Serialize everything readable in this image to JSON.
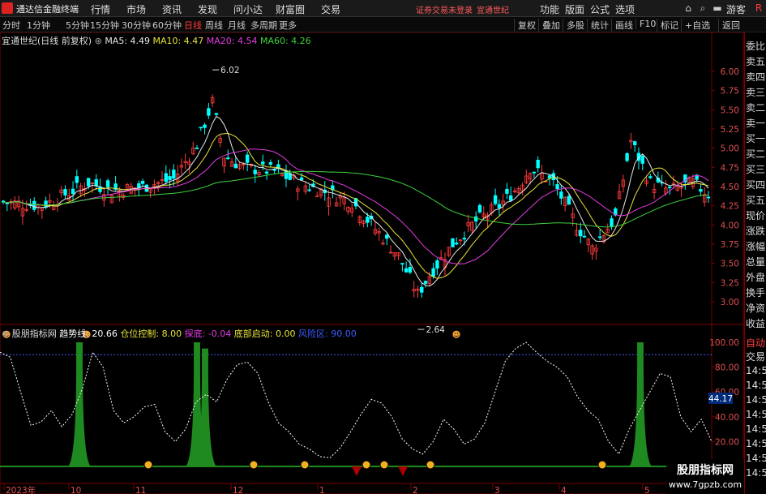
{
  "app": {
    "title": "通达信金融终端",
    "menu": [
      "行情",
      "市场",
      "资讯",
      "发现",
      "问小达",
      "财富圈",
      "交易"
    ],
    "login_warning": "证券交易未登录",
    "login_stock": "宜通世纪",
    "right_menu": [
      "功能",
      "版面",
      "公式",
      "选项"
    ],
    "user": "游客"
  },
  "toolbar": {
    "periods": [
      "分时",
      "1分钟",
      "5分钟",
      "15分钟",
      "30分钟",
      "60分钟",
      "日线",
      "周线",
      "月线",
      "多周期",
      "更多"
    ],
    "active_period": "日线",
    "right_buttons": [
      "复权",
      "叠加",
      "多股",
      "统计",
      "画线",
      "F10",
      "标记",
      "+自选",
      "返回"
    ]
  },
  "main_chart": {
    "stock_title": "宜通世纪(日线 前复权)",
    "ma5_label": "MA5: 4.49",
    "ma10_label": "MA10: 4.47",
    "ma20_label": "MA20: 4.54",
    "ma60_label": "MA60: 4.26",
    "price_axis": [
      "6.00",
      "5.75",
      "5.50",
      "5.25",
      "5.00",
      "4.75",
      "4.50",
      "4.25",
      "4.00",
      "3.75",
      "3.50",
      "3.25",
      "3.00"
    ],
    "high_label": "6.02",
    "low_label": "2.64"
  },
  "indicator": {
    "name": "股朋指标网",
    "trend_label": "趋势线: 20.66",
    "position_label": "仓位控制: 8.00",
    "probe_label": "探底: -0.04",
    "bottom_label": "底部启动: 0.00",
    "risk_label": "风险区: 90.00",
    "axis": [
      "100.00",
      "80.00",
      "60.00",
      "40.00",
      "20.00"
    ],
    "current_value": "44.17"
  },
  "date_axis": [
    "2023年",
    "10",
    "11",
    "12",
    "1",
    "2",
    "3",
    "4",
    "5"
  ],
  "right_panel": {
    "items": [
      "委比",
      "卖五",
      "卖四",
      "卖三",
      "卖二",
      "卖一",
      "买一",
      "买二",
      "买三",
      "买四",
      "买五",
      "现价",
      "涨跌",
      "涨幅",
      "总量",
      "外盘",
      "换手",
      "净资",
      "收益"
    ],
    "bottom_items": [
      "自动",
      "交易",
      "14:56",
      "14:56",
      "14:56",
      "14:56",
      "14:56",
      "14:56",
      "14:56",
      "14:56"
    ]
  },
  "watermark": {
    "title": "股朋指标网",
    "url": "www.7gpzb.com"
  },
  "colors": {
    "up": "#ff3b3b",
    "down": "#00ffff",
    "ma5": "#e8e8e8",
    "ma10": "#e7e33b",
    "ma20": "#e23ce2",
    "ma60": "#3ed13e",
    "bars": "#1f8a1f"
  }
}
